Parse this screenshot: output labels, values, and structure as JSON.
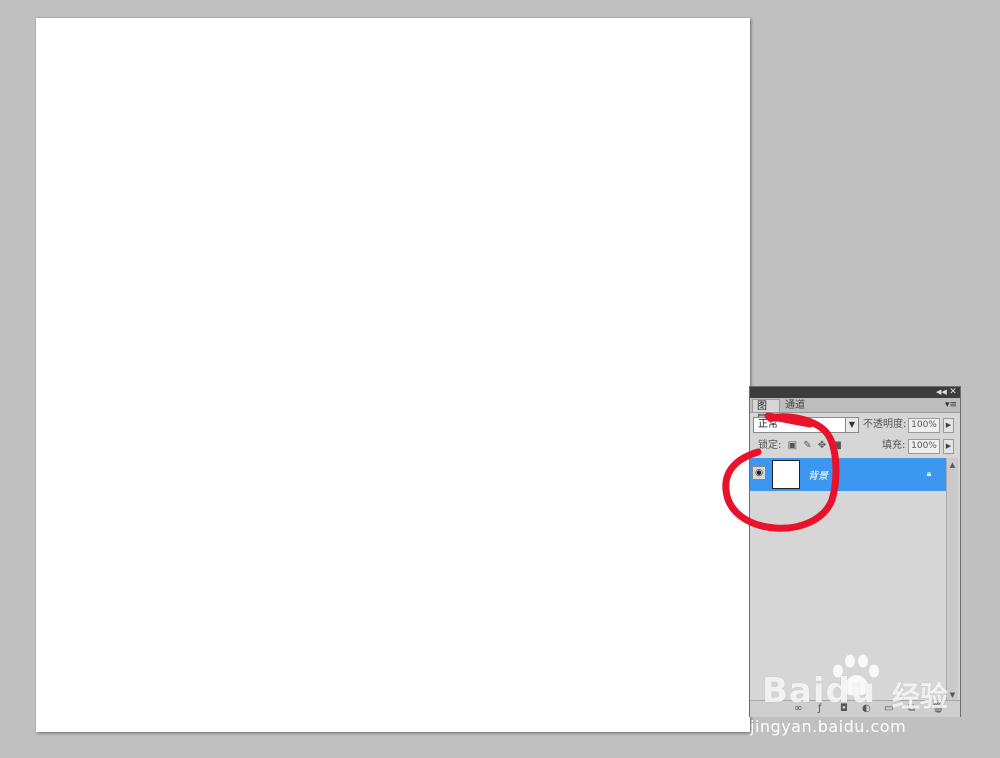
{
  "panel": {
    "tabs": [
      {
        "label": "图层",
        "active": true
      },
      {
        "label": "通道",
        "active": false
      }
    ],
    "blend_mode": "正常",
    "opacity_label": "不透明度:",
    "opacity_value": "100%",
    "lock_label": "锁定:",
    "fill_label": "填充:",
    "fill_value": "100%",
    "layers": [
      {
        "name": "背景",
        "selected": true,
        "visible": true,
        "locked": true
      }
    ]
  },
  "watermark": {
    "brand": "Baidu",
    "product": "经验",
    "url": "jingyan.baidu.com"
  },
  "colors": {
    "workspace": "#c0c0c0",
    "selection": "#3b97f0",
    "annotation": "#e8132a"
  }
}
